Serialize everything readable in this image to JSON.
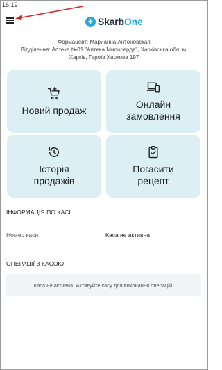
{
  "status_bar": {
    "time": "16:19"
  },
  "header": {
    "logo_main": "Skarb",
    "logo_accent": "One",
    "logo_mark": "+"
  },
  "info": {
    "pharmacist": "Фармацевт: Марианна Антоновская",
    "department_line1": "Відділення: Аптека  №01  \"Аптека Милосердя\", Харківська обл. м.",
    "department_line2": "Харків, Героїв Харкова 197"
  },
  "tiles": [
    {
      "label": "Новий продаж",
      "icon": "cart-icon"
    },
    {
      "label_line1": "Онлайн",
      "label_line2": "замовлення",
      "icon": "devices-icon"
    },
    {
      "label_line1": "Історія",
      "label_line2": "продажів",
      "icon": "history-icon"
    },
    {
      "label_line1": "Погасити",
      "label_line2": "рецепт",
      "icon": "clipboard-check-icon"
    }
  ],
  "cash_info": {
    "title": "ІНФОРМАЦІЯ ПО КАСІ",
    "register_label": "Номер каси",
    "register_value": "Каса не активна"
  },
  "operations": {
    "title": "ОПЕРАЦІЇ З КАСОЮ",
    "notice": "Каса не активна. Активуйте касу для виконання операцій."
  },
  "colors": {
    "tile_bg": "#dbeff5",
    "brand_blue": "#29a9d8",
    "annotation_arrow": "#e02020"
  }
}
